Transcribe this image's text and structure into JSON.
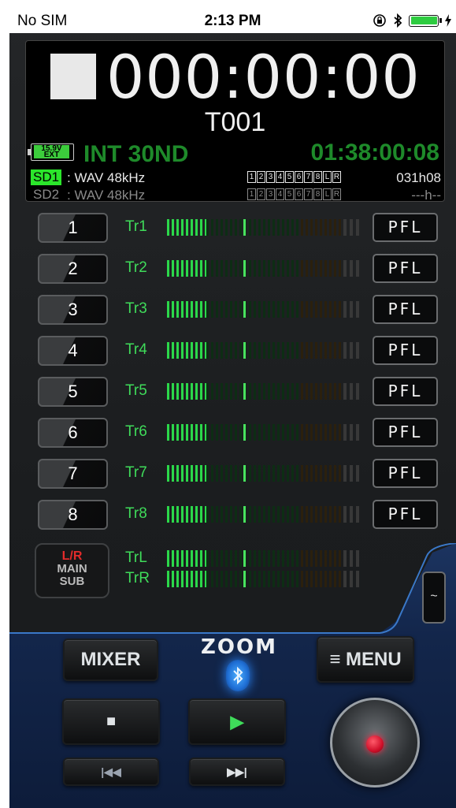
{
  "status_bar": {
    "carrier": "No SIM",
    "time": "2:13 PM"
  },
  "display": {
    "counter": "000:00:00",
    "take": "T001",
    "battery_label": "15.9V EXT",
    "input": "INT 30ND",
    "remaining": "01:38:00:08",
    "sd1": {
      "name": "SD1",
      "format": ": WAV 48kHz",
      "tracks": [
        "1",
        "2",
        "3",
        "4",
        "5",
        "6",
        "7",
        "8",
        "L",
        "R"
      ],
      "time": "031h08"
    },
    "sd2": {
      "name": "SD2",
      "format": ": WAV 48kHz",
      "tracks": [
        "1",
        "2",
        "3",
        "4",
        "5",
        "6",
        "7",
        "8",
        "L",
        "R"
      ],
      "time": "---h--"
    }
  },
  "tracks": [
    {
      "number": "1",
      "label": "Tr1",
      "pfl": "PFL"
    },
    {
      "number": "2",
      "label": "Tr2",
      "pfl": "PFL"
    },
    {
      "number": "3",
      "label": "Tr3",
      "pfl": "PFL"
    },
    {
      "number": "4",
      "label": "Tr4",
      "pfl": "PFL"
    },
    {
      "number": "5",
      "label": "Tr5",
      "pfl": "PFL"
    },
    {
      "number": "6",
      "label": "Tr6",
      "pfl": "PFL"
    },
    {
      "number": "7",
      "label": "Tr7",
      "pfl": "PFL"
    },
    {
      "number": "8",
      "label": "Tr8",
      "pfl": "PFL"
    }
  ],
  "main": {
    "lr": "L/R",
    "main": "MAIN",
    "sub": "SUB",
    "trl": "TrL",
    "trr": "TrR"
  },
  "controls": {
    "mixer": "MIXER",
    "menu": "≡ MENU",
    "logo": "ZOOM",
    "stop": "■",
    "play": "▶",
    "rewind": "|◀◀",
    "forward": "▶▶|"
  },
  "colors": {
    "accent_green": "#3fdc5a",
    "rec_red": "#d0102a",
    "panel_blue": "#13264b"
  },
  "icons": [
    "lock-rotation-icon",
    "bluetooth-icon",
    "battery-icon",
    "charging-icon"
  ]
}
